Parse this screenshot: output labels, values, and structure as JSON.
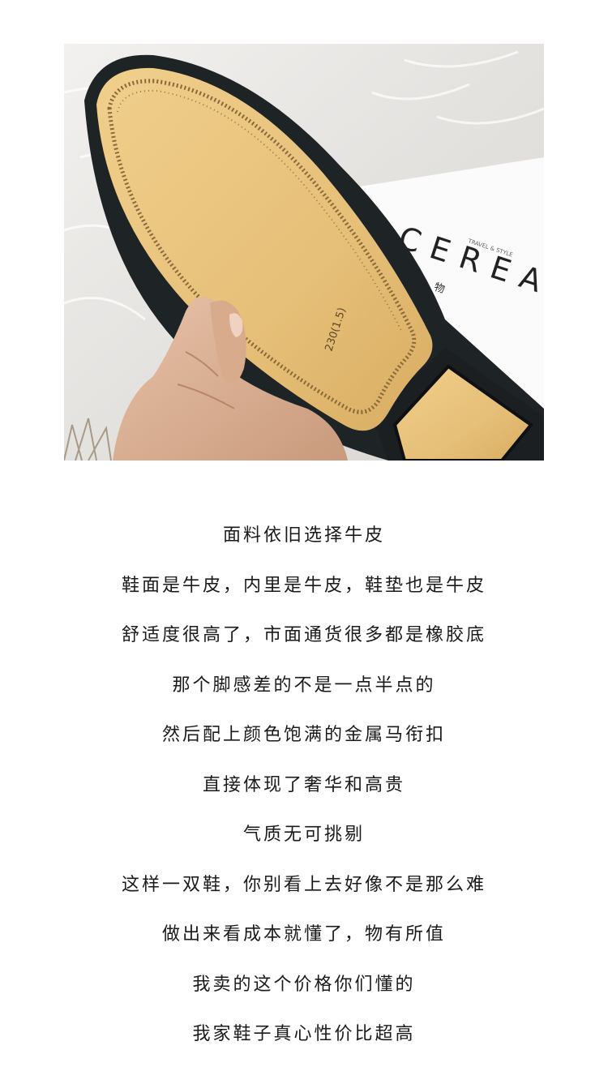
{
  "product_photo": {
    "magazine_title": "CEREAL",
    "magazine_subtitle": "谷物",
    "magazine_tagline": "TRAVEL & STYLE",
    "sole_size_mark": "230(1.5)"
  },
  "description_lines": [
    "面料依旧选择牛皮",
    "鞋面是牛皮，内里是牛皮，鞋垫也是牛皮",
    "舒适度很高了，市面通货很多都是橡胶底",
    "那个脚感差的不是一点半点的",
    "然后配上颜色饱满的金属马衔扣",
    "直接体现了奢华和高贵",
    "气质无可挑剔",
    "这样一双鞋，你别看上去好像不是那么难",
    "做出来看成本就懂了，物有所值",
    "我卖的这个价格你们懂的",
    "我家鞋子真心性价比超高"
  ]
}
